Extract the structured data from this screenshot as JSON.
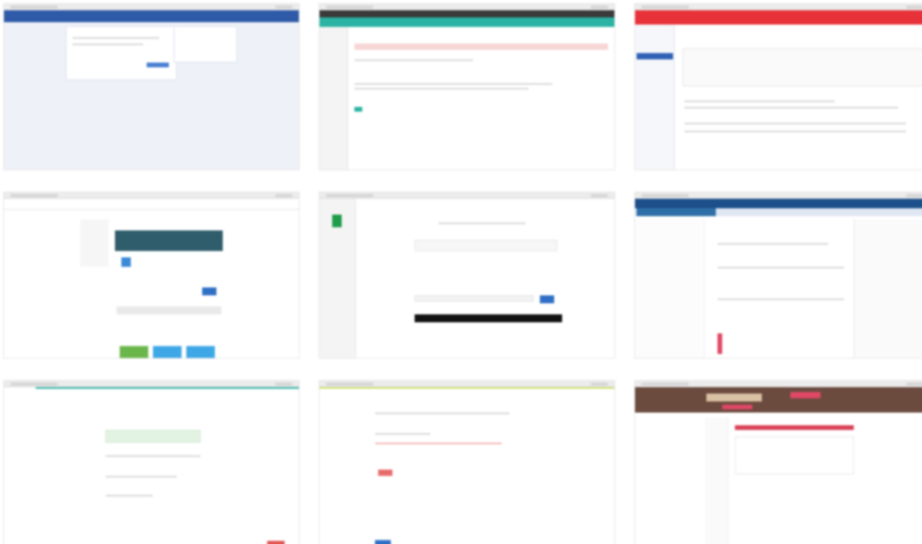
{
  "screenshots": [
    {
      "id": "s1",
      "label": ""
    },
    {
      "id": "s2",
      "label": ""
    },
    {
      "id": "s3",
      "label": ""
    },
    {
      "id": "s4",
      "label": ""
    },
    {
      "id": "s5",
      "label": ""
    },
    {
      "id": "s6",
      "label": ""
    },
    {
      "id": "s7",
      "label": ""
    },
    {
      "id": "s8",
      "label": ""
    },
    {
      "id": "s9",
      "label": ""
    }
  ],
  "colors": {
    "facebook_blue": "#3b5998",
    "teal": "#2bb3a3",
    "red": "#e8323a",
    "dark_teal": "#2f5d6b",
    "light_blue": "#3a8ad8",
    "navy": "#1d4f8a",
    "green": "#6bb64a",
    "pink": "#e04866",
    "brown": "#6b4b3e"
  }
}
